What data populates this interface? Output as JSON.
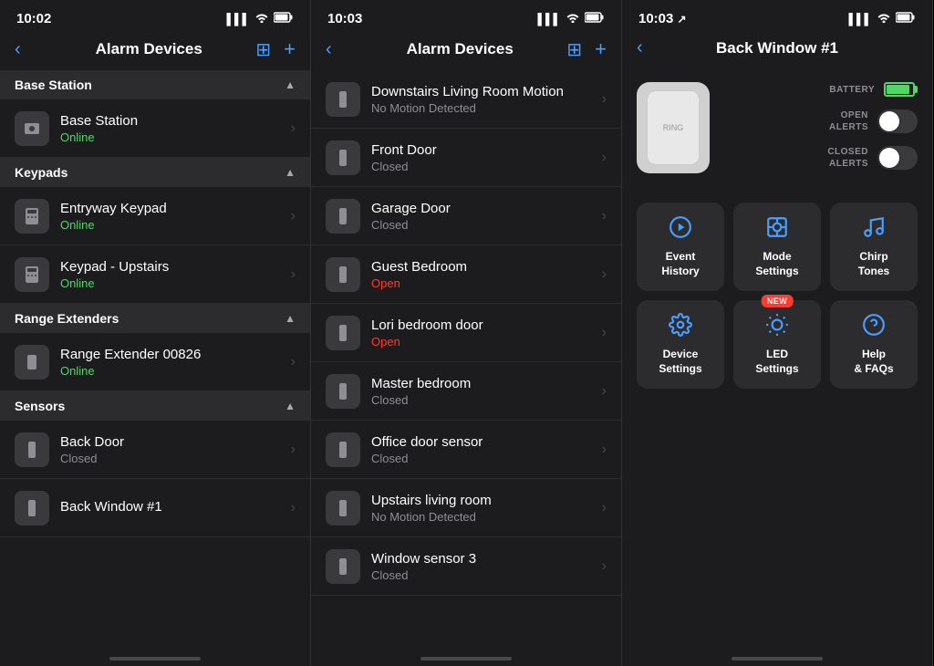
{
  "phone1": {
    "statusBar": {
      "time": "10:02",
      "signal": "▌▌▌",
      "wifi": "WiFi",
      "battery": "🔋"
    },
    "navTitle": "Alarm Devices",
    "sections": [
      {
        "id": "base-station",
        "title": "Base Station",
        "items": [
          {
            "name": "Base Station",
            "status": "Online",
            "statusType": "online"
          }
        ]
      },
      {
        "id": "keypads",
        "title": "Keypads",
        "items": [
          {
            "name": "Entryway Keypad",
            "status": "Online",
            "statusType": "online"
          },
          {
            "name": "Keypad - Upstairs",
            "status": "Online",
            "statusType": "online"
          }
        ]
      },
      {
        "id": "range-extenders",
        "title": "Range Extenders",
        "items": [
          {
            "name": "Range Extender 00826",
            "status": "Online",
            "statusType": "online"
          }
        ]
      },
      {
        "id": "sensors",
        "title": "Sensors",
        "items": [
          {
            "name": "Back Door",
            "status": "Closed",
            "statusType": "closed"
          },
          {
            "name": "Back Window #1",
            "status": "",
            "statusType": "closed"
          }
        ]
      }
    ]
  },
  "phone2": {
    "statusBar": {
      "time": "10:03",
      "signal": "▌▌▌",
      "wifi": "WiFi",
      "battery": "🔋"
    },
    "navTitle": "Alarm Devices",
    "devices": [
      {
        "name": "Downstairs Living Room Motion",
        "status": "No Motion Detected",
        "statusType": "no-motion"
      },
      {
        "name": "Front Door",
        "status": "Closed",
        "statusType": "closed"
      },
      {
        "name": "Garage Door",
        "status": "Closed",
        "statusType": "closed"
      },
      {
        "name": "Guest Bedroom",
        "status": "Open",
        "statusType": "open"
      },
      {
        "name": "Lori bedroom door",
        "status": "Open",
        "statusType": "open"
      },
      {
        "name": "Master bedroom",
        "status": "Closed",
        "statusType": "closed"
      },
      {
        "name": "Office door sensor",
        "status": "Closed",
        "statusType": "closed"
      },
      {
        "name": "Upstairs living room",
        "status": "No Motion Detected",
        "statusType": "no-motion"
      },
      {
        "name": "Window sensor 3",
        "status": "Closed",
        "statusType": "closed"
      }
    ]
  },
  "phone3": {
    "statusBar": {
      "time": "10:03",
      "locationArrow": "↗",
      "signal": "▌▌▌",
      "wifi": "WiFi",
      "battery": "🔋"
    },
    "navTitle": "Back Window #1",
    "batteryLabel": "BATTERY",
    "openAlertsLabel": "OPEN\nALERTS",
    "closedAlertsLabel": "CLOSED\nALERTS",
    "actions": [
      {
        "id": "event-history",
        "icon": "▶",
        "label": "Event\nHistory",
        "new": false
      },
      {
        "id": "mode-settings",
        "icon": "◉",
        "label": "Mode\nSettings",
        "new": false
      },
      {
        "id": "chirp-tones",
        "icon": "♪",
        "label": "Chirp\nTones",
        "new": false
      },
      {
        "id": "device-settings",
        "icon": "⚙",
        "label": "Device\nSettings",
        "new": false
      },
      {
        "id": "led-settings",
        "icon": "✦",
        "label": "LED\nSettings",
        "new": true,
        "newLabel": "NEW"
      },
      {
        "id": "help-faqs",
        "icon": "?",
        "label": "Help\n& FAQs",
        "new": false
      }
    ]
  }
}
